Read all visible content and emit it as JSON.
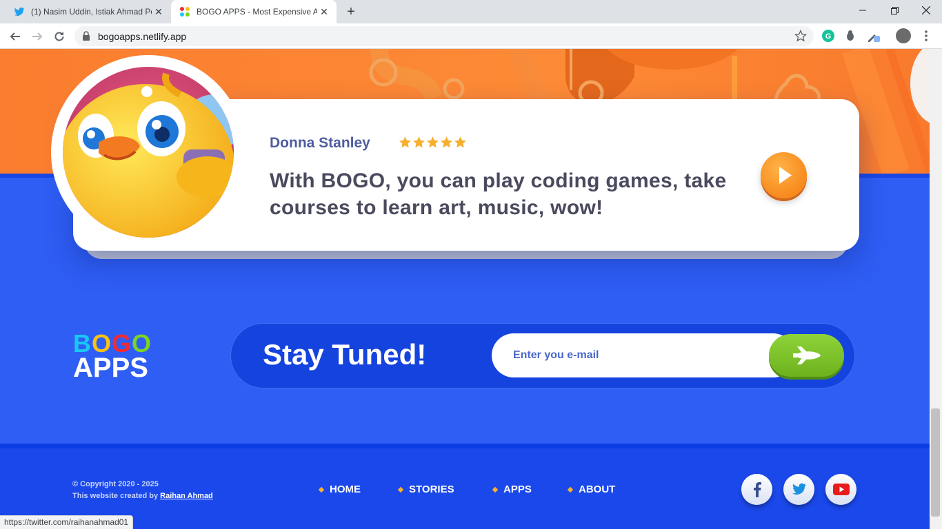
{
  "browser": {
    "tabs": [
      {
        "title": "(1) Nasim Uddin, Istiak Ahmad Po",
        "icon": "twitter-icon",
        "active": false
      },
      {
        "title": "BOGO APPS - Most Expensive Ap",
        "icon": "bogo-favicon",
        "active": true
      }
    ],
    "url": "bogoapps.netlify.app",
    "status_url": "https://twitter.com/raihanahmad01"
  },
  "review": {
    "name": "Donna Stanley",
    "rating": 5,
    "text": "With BOGO, you can play coding games, take courses to learn art, music, wow!"
  },
  "brand": {
    "letters": [
      {
        "char": "B",
        "color": "#19c8f4"
      },
      {
        "char": "O",
        "color": "#f9c215"
      },
      {
        "char": "G",
        "color": "#f02b35"
      },
      {
        "char": "O",
        "color": "#7ed321"
      }
    ],
    "apps": "APPS"
  },
  "newsletter": {
    "title": "Stay Tuned!",
    "placeholder": "Enter you e-mail"
  },
  "footer": {
    "copyright": "© Copyright 2020 - 2025",
    "credit_prefix": "This website created by",
    "credit_name": "Raihan Ahmad",
    "nav": [
      "HOME",
      "STORIES",
      "APPS",
      "ABOUT"
    ],
    "social": [
      "facebook-icon",
      "twitter-icon",
      "youtube-icon"
    ]
  },
  "colors": {
    "orange": "#fb7d2f",
    "blue": "#2f5ef5",
    "footer": "#1a48ea",
    "green": "#7ec329",
    "star": "#f7b02b"
  }
}
